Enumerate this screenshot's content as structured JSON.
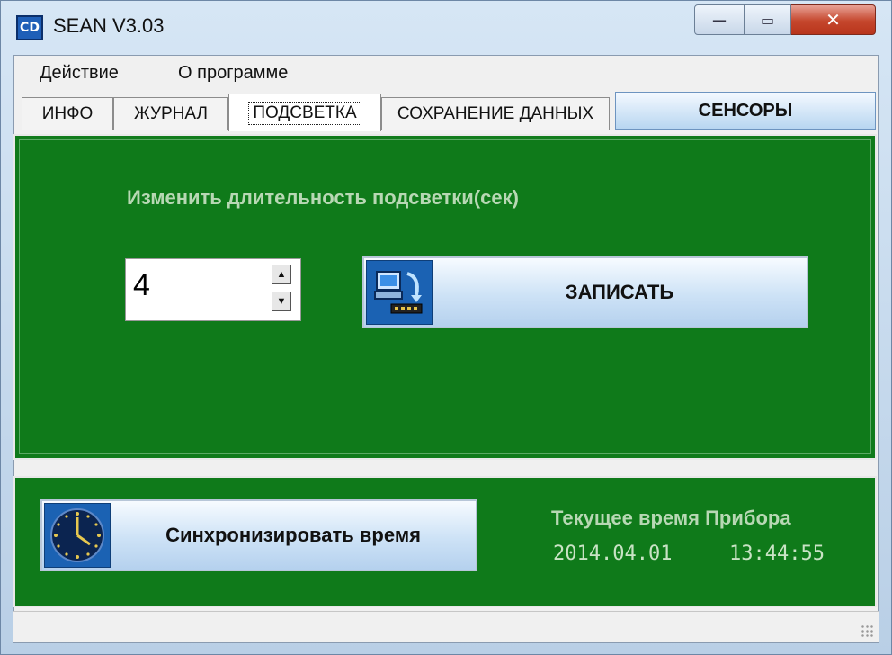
{
  "window": {
    "icon_text": "CD",
    "title": "SEAN V3.03",
    "controls": {
      "minimize": "—",
      "maximize": "▭",
      "close": "✕"
    }
  },
  "menu": {
    "items": [
      "Действие",
      "О программе"
    ]
  },
  "tabs": [
    {
      "label": "ИНФО"
    },
    {
      "label": "ЖУРНАЛ"
    },
    {
      "label": "ПОДСВЕТКА",
      "active": true
    },
    {
      "label": "СОХРАНЕНИЕ ДАННЫХ"
    },
    {
      "label": "СЕНСОРЫ"
    }
  ],
  "backlight": {
    "duration_label": "Изменить длительность подсветки(сек)",
    "duration_value": "4",
    "write_button": "ЗАПИСАТЬ"
  },
  "time_panel": {
    "sync_button": "Синхронизировать время",
    "current_time_label": "Текущее время Прибора",
    "date": "2014.04.01",
    "time": "13:44:55"
  },
  "colors": {
    "panel_green": "#0f7a1a",
    "label_green": "#b8d8b4",
    "button_blue": "#1b62b3"
  },
  "icons": {
    "write_button_icon": "computer-transfer-icon",
    "sync_button_icon": "clock-icon"
  }
}
